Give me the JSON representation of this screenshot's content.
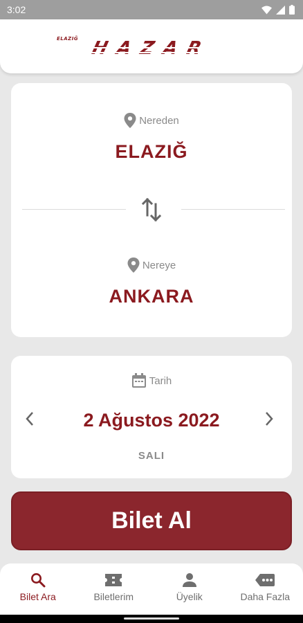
{
  "status_bar": {
    "time": "3:02"
  },
  "brand": {
    "city": "ELAZIĞ",
    "name": "HAZAR"
  },
  "route": {
    "from_label": "Nereden",
    "from_city": "ELAZIĞ",
    "to_label": "Nereye",
    "to_city": "ANKARA"
  },
  "date": {
    "label": "Tarih",
    "value": "2 Ağustos 2022",
    "weekday": "SALI"
  },
  "buy_button_label": "Bilet Al",
  "nav": {
    "items": [
      {
        "label": "Bilet Ara",
        "icon": "search-icon",
        "active": true
      },
      {
        "label": "Biletlerim",
        "icon": "ticket-icon",
        "active": false
      },
      {
        "label": "Üyelik",
        "icon": "person-icon",
        "active": false
      },
      {
        "label": "Daha Fazla",
        "icon": "more-icon",
        "active": false
      }
    ]
  },
  "colors": {
    "accent": "#8b1a1f",
    "button": "#8b262d",
    "muted": "#8a8a8a",
    "background": "#e8e8e8"
  }
}
